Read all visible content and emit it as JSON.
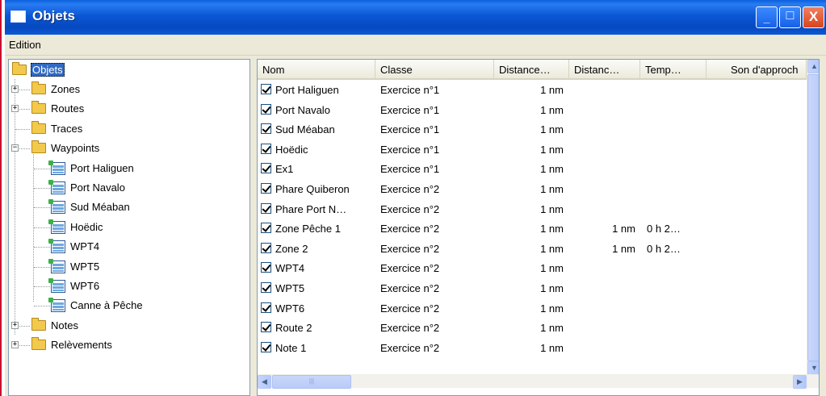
{
  "window": {
    "title": "Objets",
    "minimize_glyph": "_",
    "maximize_glyph": "□",
    "close_glyph": "X"
  },
  "menu": {
    "items": [
      "Edition"
    ]
  },
  "tree": {
    "root": "Objets",
    "nodes": [
      {
        "label": "Zones",
        "type": "folder",
        "expander": "+"
      },
      {
        "label": "Routes",
        "type": "folder",
        "expander": "+"
      },
      {
        "label": "Traces",
        "type": "folder",
        "expander": ""
      },
      {
        "label": "Waypoints",
        "type": "folder",
        "expander": "−"
      },
      {
        "label": "Port Haliguen",
        "type": "waypoint"
      },
      {
        "label": "Port Navalo",
        "type": "waypoint"
      },
      {
        "label": "Sud Méaban",
        "type": "waypoint"
      },
      {
        "label": "Hoëdic",
        "type": "waypoint"
      },
      {
        "label": "WPT4",
        "type": "waypoint"
      },
      {
        "label": "WPT5",
        "type": "waypoint"
      },
      {
        "label": "WPT6",
        "type": "waypoint"
      },
      {
        "label": "Canne à Pêche",
        "type": "waypoint"
      },
      {
        "label": "Notes",
        "type": "folder",
        "expander": "+"
      },
      {
        "label": "Relèvements",
        "type": "folder",
        "expander": "+"
      }
    ]
  },
  "list": {
    "columns": [
      "Nom",
      "Classe",
      "Distance…",
      "Distanc…",
      "Temp…",
      "Son d'approch"
    ],
    "rows": [
      {
        "nom": "Port Haliguen",
        "classe": "Exercice n°1",
        "dist1": "1 nm",
        "dist2": "",
        "temps": ""
      },
      {
        "nom": "Port Navalo",
        "classe": "Exercice n°1",
        "dist1": "1 nm",
        "dist2": "",
        "temps": ""
      },
      {
        "nom": "Sud Méaban",
        "classe": "Exercice n°1",
        "dist1": "1 nm",
        "dist2": "",
        "temps": ""
      },
      {
        "nom": "Hoëdic",
        "classe": "Exercice n°1",
        "dist1": "1 nm",
        "dist2": "",
        "temps": ""
      },
      {
        "nom": "Ex1",
        "classe": "Exercice n°1",
        "dist1": "1 nm",
        "dist2": "",
        "temps": ""
      },
      {
        "nom": "Phare Quiberon",
        "classe": "Exercice n°2",
        "dist1": "1 nm",
        "dist2": "",
        "temps": ""
      },
      {
        "nom": "Phare Port N…",
        "classe": "Exercice n°2",
        "dist1": "1 nm",
        "dist2": "",
        "temps": ""
      },
      {
        "nom": "Zone Pêche 1",
        "classe": "Exercice n°2",
        "dist1": "1 nm",
        "dist2": "1 nm",
        "temps": "0 h 2…"
      },
      {
        "nom": "Zone 2",
        "classe": "Exercice n°2",
        "dist1": "1 nm",
        "dist2": "1 nm",
        "temps": "0 h 2…"
      },
      {
        "nom": "WPT4",
        "classe": "Exercice n°2",
        "dist1": "1 nm",
        "dist2": "",
        "temps": ""
      },
      {
        "nom": "WPT5",
        "classe": "Exercice n°2",
        "dist1": "1 nm",
        "dist2": "",
        "temps": ""
      },
      {
        "nom": "WPT6",
        "classe": "Exercice n°2",
        "dist1": "1 nm",
        "dist2": "",
        "temps": ""
      },
      {
        "nom": "Route 2",
        "classe": "Exercice n°2",
        "dist1": "1 nm",
        "dist2": "",
        "temps": ""
      },
      {
        "nom": "Note 1",
        "classe": "Exercice n°2",
        "dist1": "1 nm",
        "dist2": "",
        "temps": ""
      }
    ]
  },
  "scrollbars": {
    "up": "▲",
    "down": "▼",
    "left": "◀",
    "right": "▶",
    "grip": "|||"
  }
}
